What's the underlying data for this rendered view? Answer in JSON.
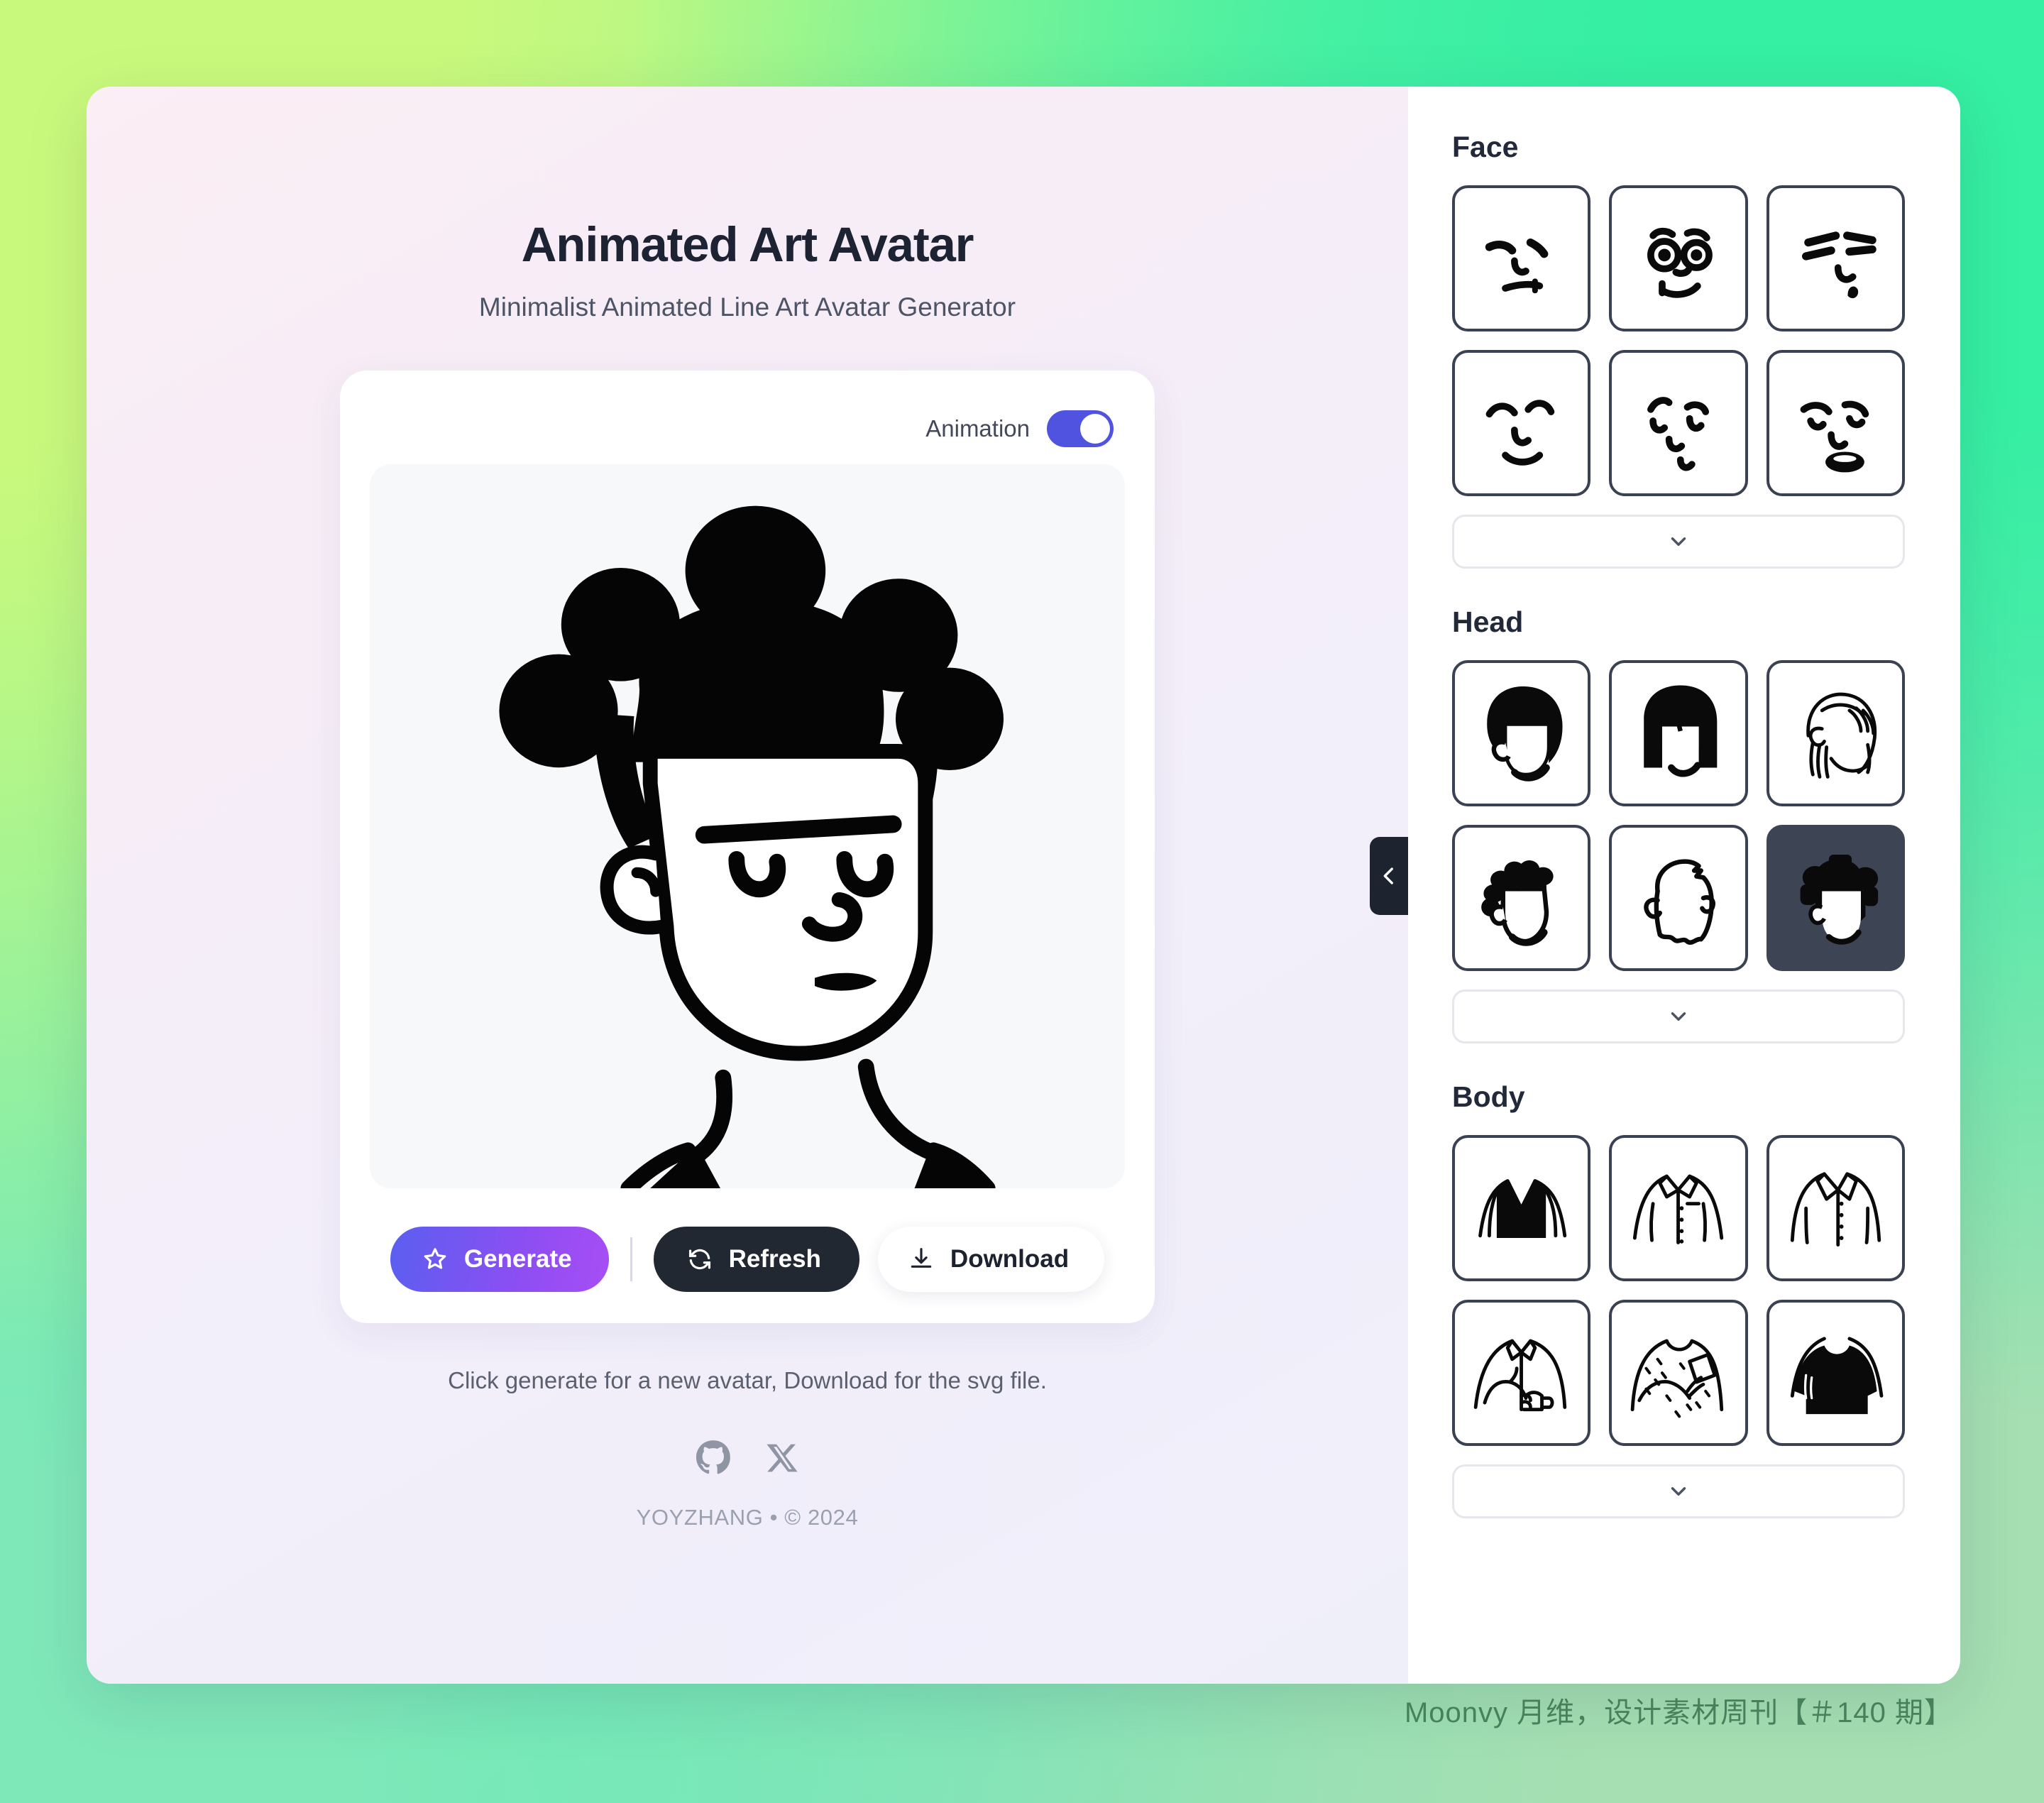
{
  "header": {
    "title": "Animated Art Avatar",
    "subtitle": "Minimalist Animated Line Art Avatar Generator"
  },
  "card": {
    "animation_label": "Animation",
    "animation_on": true
  },
  "actions": {
    "generate_label": "Generate",
    "refresh_label": "Refresh",
    "download_label": "Download"
  },
  "footer": {
    "hint": "Click generate for a new avatar, Download for the svg file.",
    "copyright": "YOYZHANG  •  © 2024",
    "social": [
      {
        "name": "github-icon",
        "label": "GitHub"
      },
      {
        "name": "x-icon",
        "label": "X"
      }
    ]
  },
  "sidebar": {
    "collapse_handle": "chevron-left-icon",
    "sections": [
      {
        "title": "Face",
        "expand_icon": "chevron-down-icon",
        "items": [
          {
            "id": "face-1",
            "label": "Smirk face",
            "selected": false
          },
          {
            "id": "face-2",
            "label": "Wide eyes smile face",
            "selected": false
          },
          {
            "id": "face-3",
            "label": "Tired sweat face",
            "selected": false
          },
          {
            "id": "face-4",
            "label": "Happy arch eyes face",
            "selected": false
          },
          {
            "id": "face-5",
            "label": "Surprised face",
            "selected": false
          },
          {
            "id": "face-6",
            "label": "Sad open mouth face",
            "selected": false
          }
        ]
      },
      {
        "title": "Head",
        "expand_icon": "chevron-down-icon",
        "items": [
          {
            "id": "head-1",
            "label": "Afro hair",
            "selected": false
          },
          {
            "id": "head-2",
            "label": "Bob cut with bangs",
            "selected": false
          },
          {
            "id": "head-3",
            "label": "Line art long hair",
            "selected": false
          },
          {
            "id": "head-4",
            "label": "Curly spiky hair",
            "selected": false
          },
          {
            "id": "head-5",
            "label": "Short sketch hair",
            "selected": false
          },
          {
            "id": "head-6",
            "label": "Bantu knots hair",
            "selected": true
          }
        ]
      },
      {
        "title": "Body",
        "expand_icon": "chevron-down-icon",
        "items": [
          {
            "id": "body-1",
            "label": "Suit with black vest",
            "selected": false
          },
          {
            "id": "body-2",
            "label": "Collared shirt with pocket",
            "selected": false
          },
          {
            "id": "body-3",
            "label": "Open collar shirt",
            "selected": false
          },
          {
            "id": "body-4",
            "label": "Holding a mug",
            "selected": false
          },
          {
            "id": "body-5",
            "label": "Patterned shirt holding phone",
            "selected": false
          },
          {
            "id": "body-6",
            "label": "Black tee",
            "selected": false
          }
        ]
      }
    ]
  },
  "watermark": "Moonvy 月维，设计素材周刊【＃140 期】",
  "colors": {
    "accent_indigo": "#4f53e0",
    "generate_gradient_from": "#5a5ff0",
    "generate_gradient_to": "#a74ef5",
    "dark": "#222832",
    "selected_thumb_bg": "#3d4453",
    "bg_green_tr": "#35efa2",
    "bg_lime_tl": "#c9f97c",
    "bg_mint_br": "#a5dfb2",
    "panel_lavender": "#f1eefa",
    "watermark_green": "#3f7a55"
  }
}
